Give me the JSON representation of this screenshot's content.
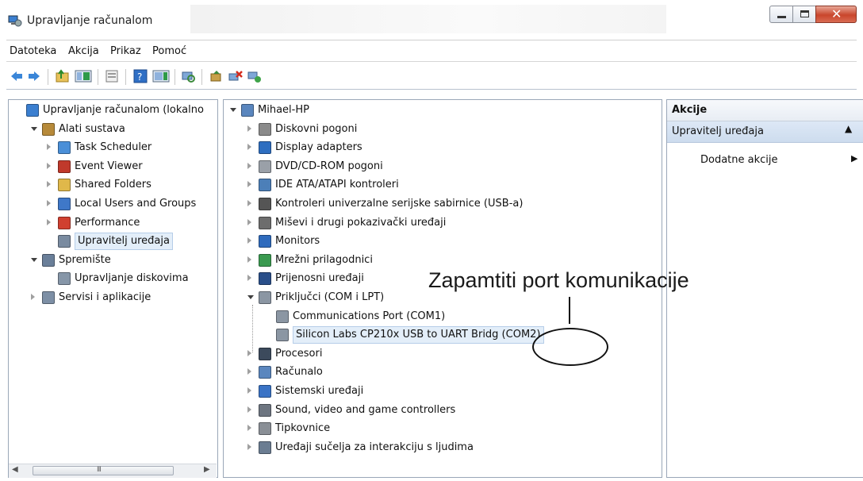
{
  "window": {
    "title": "Upravljanje računalom"
  },
  "menu": [
    "Datoteka",
    "Akcija",
    "Prikaz",
    "Pomoć"
  ],
  "left_tree": [
    {
      "label": "Upravljanje računalom (lokalno",
      "icon": "computer-mgmt-icon",
      "level": 0,
      "expander": "none"
    },
    {
      "label": "Alati sustava",
      "icon": "tools-icon",
      "level": 1,
      "expander": "open"
    },
    {
      "label": "Task Scheduler",
      "icon": "clock-icon",
      "level": 2,
      "expander": "closed"
    },
    {
      "label": "Event Viewer",
      "icon": "event-viewer-icon",
      "level": 2,
      "expander": "closed"
    },
    {
      "label": "Shared Folders",
      "icon": "shared-folder-icon",
      "level": 2,
      "expander": "closed"
    },
    {
      "label": "Local Users and Groups",
      "icon": "users-icon",
      "level": 2,
      "expander": "closed"
    },
    {
      "label": "Performance",
      "icon": "performance-icon",
      "level": 2,
      "expander": "closed"
    },
    {
      "label": "Upravitelj uređaja",
      "icon": "device-manager-icon",
      "level": 2,
      "expander": "none",
      "selected": true
    },
    {
      "label": "Spremište",
      "icon": "storage-icon",
      "level": 1,
      "expander": "open"
    },
    {
      "label": "Upravljanje diskovima",
      "icon": "disk-mgmt-icon",
      "level": 2,
      "expander": "none"
    },
    {
      "label": "Servisi i aplikacije",
      "icon": "services-icon",
      "level": 1,
      "expander": "closed"
    }
  ],
  "device_tree": [
    {
      "label": "Mihael-HP",
      "icon": "computer-icon",
      "level": 0,
      "expander": "open"
    },
    {
      "label": "Diskovni pogoni",
      "icon": "disk-drive-icon",
      "level": 1,
      "expander": "closed"
    },
    {
      "label": "Display adapters",
      "icon": "display-adapter-icon",
      "level": 1,
      "expander": "closed"
    },
    {
      "label": "DVD/CD-ROM pogoni",
      "icon": "dvd-icon",
      "level": 1,
      "expander": "closed"
    },
    {
      "label": "IDE ATA/ATAPI kontroleri",
      "icon": "ide-icon",
      "level": 1,
      "expander": "closed"
    },
    {
      "label": "Kontroleri univerzalne serijske sabirnice (USB-a)",
      "icon": "usb-icon",
      "level": 1,
      "expander": "closed"
    },
    {
      "label": "Miševi i drugi pokazivački uređaji",
      "icon": "mouse-icon",
      "level": 1,
      "expander": "closed"
    },
    {
      "label": "Monitors",
      "icon": "monitor-icon",
      "level": 1,
      "expander": "closed"
    },
    {
      "label": "Mrežni prilagodnici",
      "icon": "network-icon",
      "level": 1,
      "expander": "closed"
    },
    {
      "label": "Prijenosni uređaji",
      "icon": "portable-device-icon",
      "level": 1,
      "expander": "closed"
    },
    {
      "label": "Priključci (COM i LPT)",
      "icon": "port-icon",
      "level": 1,
      "expander": "open"
    },
    {
      "label": "Communications Port (COM1)",
      "icon": "port-icon",
      "level": 2,
      "expander": "none"
    },
    {
      "label": "Silicon Labs CP210x USB to UART Bridg (COM2)",
      "icon": "port-icon",
      "level": 2,
      "expander": "none",
      "selected": true
    },
    {
      "label": "Procesori",
      "icon": "processor-icon",
      "level": 1,
      "expander": "closed"
    },
    {
      "label": "Računalo",
      "icon": "computer-icon",
      "level": 1,
      "expander": "closed"
    },
    {
      "label": "Sistemski uređaji",
      "icon": "system-device-icon",
      "level": 1,
      "expander": "closed"
    },
    {
      "label": "Sound, video and game controllers",
      "icon": "sound-icon",
      "level": 1,
      "expander": "closed"
    },
    {
      "label": "Tipkovnice",
      "icon": "keyboard-icon",
      "level": 1,
      "expander": "closed"
    },
    {
      "label": "Uređaji sučelja za interakciju s ljudima",
      "icon": "hid-icon",
      "level": 1,
      "expander": "closed"
    }
  ],
  "actions": {
    "header": "Akcije",
    "section": "Upravitelj uređaja",
    "item": "Dodatne akcije"
  },
  "annotation": {
    "text": "Zapamtiti port komunikacije"
  },
  "scrollbar": {
    "grip": "III"
  },
  "colors": {
    "selection": "#e3eef9",
    "pane_border": "#9aa7b8",
    "close_red": "#c9462c"
  }
}
